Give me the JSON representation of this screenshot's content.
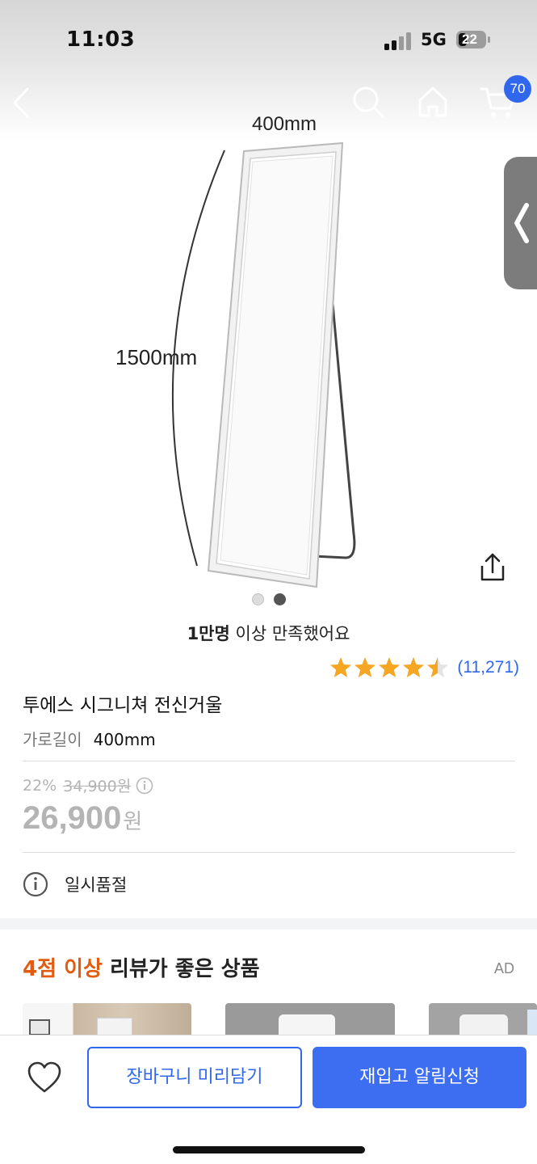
{
  "status_bar": {
    "time": "11:03",
    "network": "5G",
    "battery": "22"
  },
  "nav": {
    "back_icon": "chevron-left-icon",
    "search_icon": "search-icon",
    "home_icon": "home-icon",
    "cart_icon": "cart-icon",
    "cart_badge": "70"
  },
  "hero": {
    "width_label": "400mm",
    "height_label": "1500mm",
    "image_count": 2,
    "active_index": 2
  },
  "satisfaction": {
    "bold": "1만명",
    "rest": " 이상 만족했어요"
  },
  "rating": {
    "stars": 4.5,
    "count": "(11,271)",
    "star_color": "#f5a623"
  },
  "product": {
    "title": "투에스 시그니쳐 전신거울",
    "option_label": "가로길이",
    "option_value": "400mm"
  },
  "pricing": {
    "discount_rate": "22%",
    "original_price": "34,900원",
    "sale_price": "26,900",
    "currency": "원"
  },
  "stock": {
    "status": "일시품절"
  },
  "recommendation": {
    "accent": "4점 이상",
    "rest": " 리뷰가 좋은 상품",
    "ad_label": "AD",
    "accent_color": "#e25b0e"
  },
  "bottom_bar": {
    "wishlist_icon": "heart-icon",
    "cart_button": "장바구니 미리담기",
    "restock_button": "재입고 알림신청",
    "brand_color": "#3067ec"
  }
}
